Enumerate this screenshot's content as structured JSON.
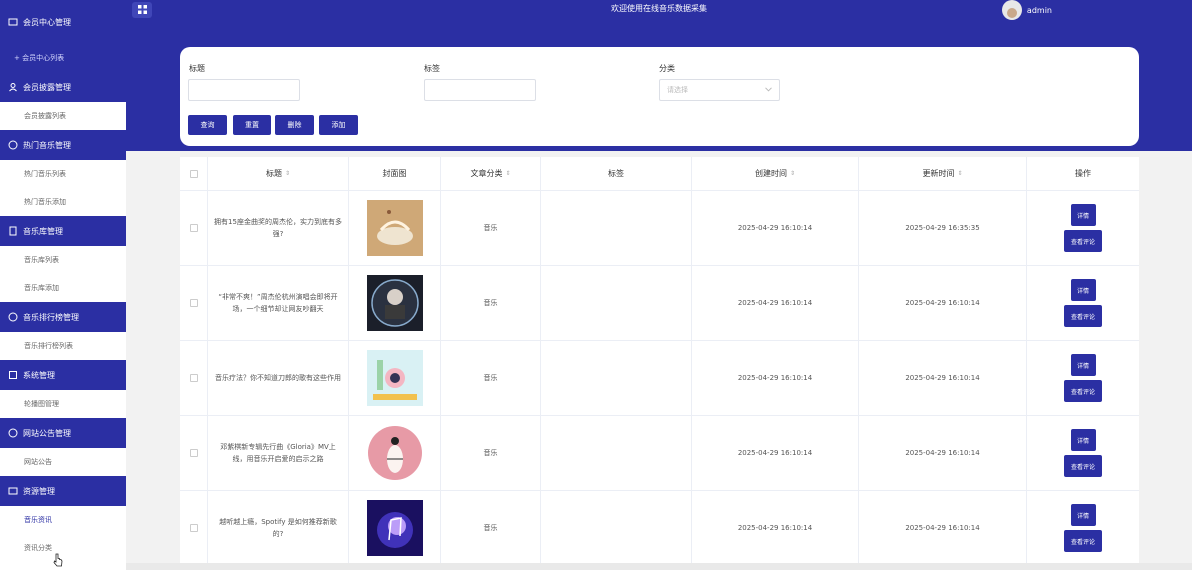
{
  "header": {
    "title": "欢迎使用在线音乐数据采集",
    "username": "admin"
  },
  "sidebar": {
    "groups": [
      {
        "label": "会员中心管理",
        "items": [
          {
            "label": "+ 会员中心列表"
          }
        ]
      },
      {
        "label": "会员披露管理",
        "items": [
          {
            "label": "会员披露列表"
          }
        ]
      },
      {
        "label": "热门音乐管理",
        "items": [
          {
            "label": "热门音乐列表"
          },
          {
            "label": "热门音乐添加"
          }
        ]
      },
      {
        "label": "音乐库管理",
        "items": [
          {
            "label": "音乐库列表"
          },
          {
            "label": "音乐库添加"
          }
        ]
      },
      {
        "label": "音乐排行榜管理",
        "items": [
          {
            "label": "音乐排行榜列表"
          }
        ]
      },
      {
        "label": "系统管理",
        "items": [
          {
            "label": "轮播图管理"
          }
        ]
      },
      {
        "label": "网站公告管理",
        "items": [
          {
            "label": "网站公告"
          }
        ]
      },
      {
        "label": "资源管理",
        "items": [
          {
            "label": "音乐资讯"
          },
          {
            "label": "资讯分类"
          }
        ]
      }
    ]
  },
  "search": {
    "title_label": "标题",
    "tag_label": "标签",
    "category_label": "分类",
    "category_placeholder": "请选择",
    "query_button": "查询",
    "reset_button": "重置",
    "delete_button": "删除",
    "add_button": "添加"
  },
  "table": {
    "columns": [
      "标题",
      "封面图",
      "文章分类",
      "标签",
      "创建时间",
      "更新时间",
      "操作"
    ],
    "detail_label": "详情",
    "comment_label": "查看评论",
    "rows": [
      {
        "title": "拥有15座金曲奖的周杰伦，实力到底有多强?",
        "category": "音乐",
        "tag": "",
        "created": "2025-04-29 16:10:14",
        "updated": "2025-04-29 16:35:35"
      },
      {
        "title": "“非常不爽！”周杰伦杭州演唱会即将开场，一个细节却让网友吵翻天",
        "category": "音乐",
        "tag": "",
        "created": "2025-04-29 16:10:14",
        "updated": "2025-04-29 16:10:14"
      },
      {
        "title": "音乐疗法？你不知道刀郎的歌有这些作用",
        "category": "音乐",
        "tag": "",
        "created": "2025-04-29 16:10:14",
        "updated": "2025-04-29 16:10:14"
      },
      {
        "title": "邓紫棋新专辑先行曲《Gloria》MV上线，用音乐开启爱的启示之路",
        "category": "音乐",
        "tag": "",
        "created": "2025-04-29 16:10:14",
        "updated": "2025-04-29 16:10:14"
      },
      {
        "title": "越听越上瘾，Spotify 是如何推荐新歌的?",
        "category": "音乐",
        "tag": "",
        "created": "2025-04-29 16:10:14",
        "updated": "2025-04-29 16:10:14"
      }
    ]
  },
  "colors": {
    "primary": "#2b2fa3",
    "border": "#ebeef5"
  },
  "icons": [
    "grid-icon",
    "user-icon",
    "chat-icon",
    "music-icon",
    "settings-icon",
    "notice-icon",
    "folder-icon",
    "sort-icon",
    "chevron-down-icon",
    "pointer-cursor-icon"
  ]
}
